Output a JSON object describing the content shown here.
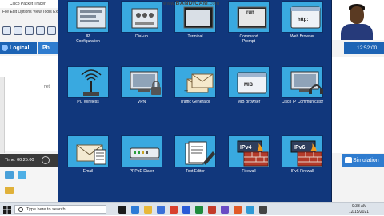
{
  "background_app": {
    "title": "Cisco Packet Tracer",
    "menu": "File Edit Options View Tools Extensions",
    "tabs": {
      "logical": "Logical",
      "physical": "Ph"
    },
    "time_label": "Time: 00:25:00",
    "clock": "12:52:00",
    "simulation": "Simulation",
    "canvas_fragment": "net"
  },
  "watermark": {
    "prefix": "www.",
    "brand": "BANDICAM",
    "suffix": ".com"
  },
  "desktop": {
    "apps": [
      {
        "id": "ip-configuration",
        "label": "IP\nConfiguration",
        "icon": "ip-config-icon"
      },
      {
        "id": "dial-up",
        "label": "Dial-up",
        "icon": "dial-up-icon"
      },
      {
        "id": "terminal",
        "label": "Terminal",
        "icon": "terminal-icon"
      },
      {
        "id": "command-prompt",
        "label": "Command\nPrompt",
        "icon": "command-prompt-icon",
        "icon_text": "run"
      },
      {
        "id": "web-browser",
        "label": "Web Browser",
        "icon": "web-browser-icon",
        "icon_text": "http:"
      },
      {
        "id": "pc-wireless",
        "label": "PC Wireless",
        "icon": "wireless-icon"
      },
      {
        "id": "vpn",
        "label": "VPN",
        "icon": "vpn-icon"
      },
      {
        "id": "traffic-generator",
        "label": "Traffic Generator",
        "icon": "traffic-generator-icon"
      },
      {
        "id": "mib-browser",
        "label": "MIB Browser",
        "icon": "mib-browser-icon",
        "icon_text": "MIB"
      },
      {
        "id": "cisco-ip-communicator",
        "label": "Cisco IP Communicator",
        "icon": "ip-communicator-icon"
      },
      {
        "id": "email",
        "label": "Email",
        "icon": "email-icon"
      },
      {
        "id": "pppoe-dialer",
        "label": "PPPoE Dialer",
        "icon": "pppoe-dialer-icon"
      },
      {
        "id": "text-editor",
        "label": "Text Editor",
        "icon": "text-editor-icon"
      },
      {
        "id": "firewall",
        "label": "Firewall",
        "icon": "firewall-icon",
        "icon_text": "IPv4"
      },
      {
        "id": "ipv6-firewall",
        "label": "IPv6 Firewall",
        "icon": "ipv6-firewall-icon",
        "icon_text": "IPv6"
      }
    ]
  },
  "taskbar": {
    "search_placeholder": "Type here to search",
    "time": "9:33 AM",
    "date": "12/15/2021"
  },
  "colors": {
    "desktop_bg": "#11377c",
    "tile_bg": "#39a9e0",
    "logical_tab": "#1d64b5"
  }
}
